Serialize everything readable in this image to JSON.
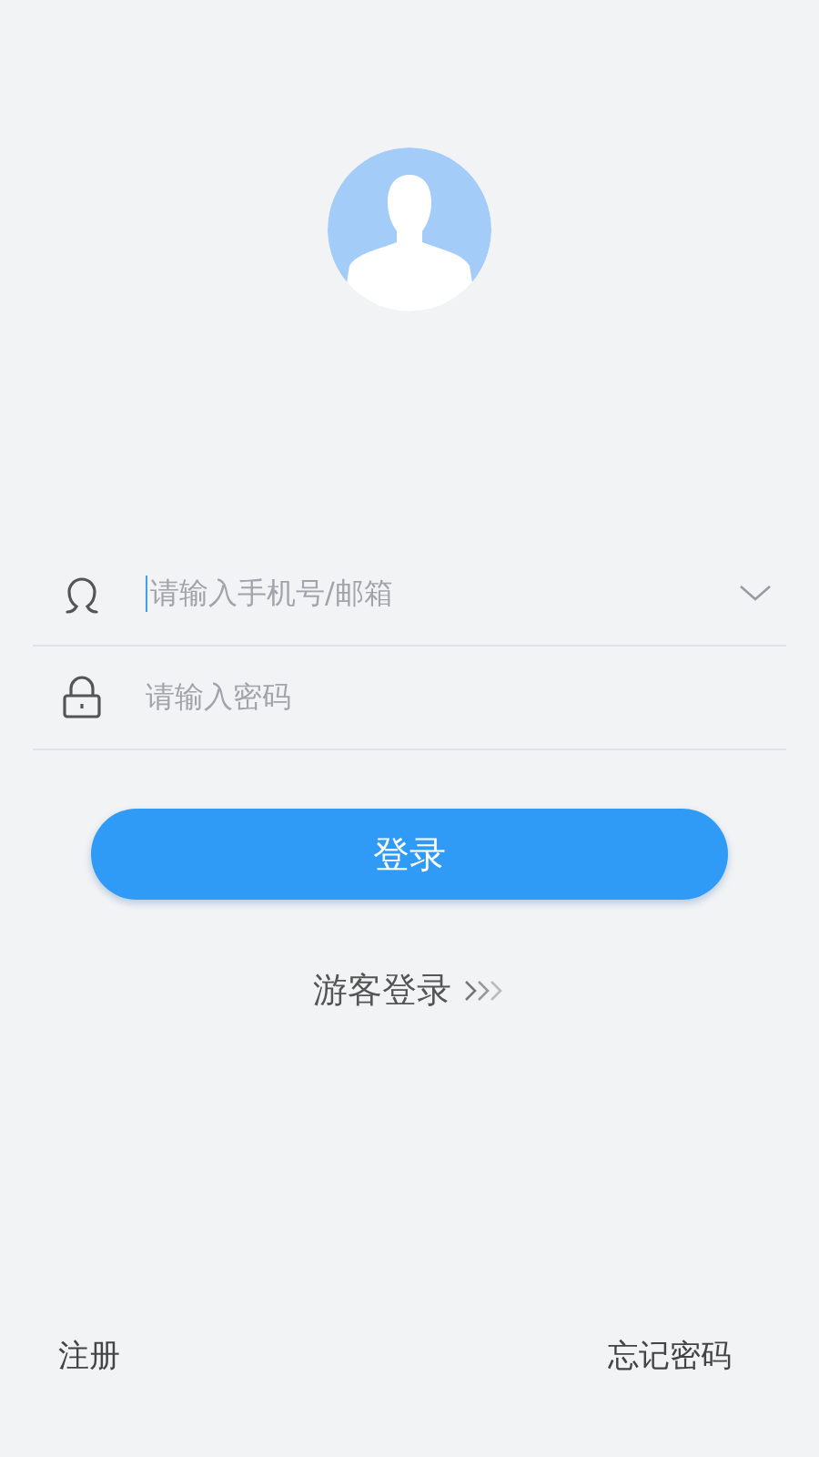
{
  "avatar": {
    "kind": "silhouette"
  },
  "fields": [
    {
      "kind": "account",
      "placeholder": "请输入手机号/邮箱",
      "focused": true,
      "dropdown": true
    },
    {
      "kind": "password",
      "placeholder": "请输入密码",
      "focused": false,
      "dropdown": false
    }
  ],
  "login_button": "登录",
  "guest_login": "游客登录",
  "footer": {
    "register": "注册",
    "forgot_password": "忘记密码"
  }
}
